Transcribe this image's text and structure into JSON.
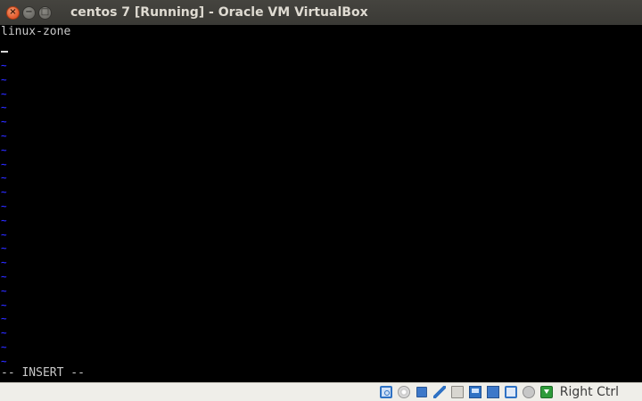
{
  "window": {
    "title": "centos 7 [Running] - Oracle VM VirtualBox",
    "buttons": {
      "close": "×",
      "minimize": "−",
      "maximize": "□"
    }
  },
  "terminal": {
    "first_line": "linux-zone",
    "empty_line_marker": "~",
    "empty_line_count": 22,
    "mode_line": "-- INSERT --",
    "colors": {
      "background": "#000000",
      "text": "#c8c8c8",
      "tilde": "#2a2aff"
    }
  },
  "statusbar": {
    "icons": [
      "hard-disk-icon",
      "optical-drive-icon",
      "network-icon",
      "usb-icon",
      "shared-folders-icon",
      "display-icon",
      "video-capture-icon",
      "cpu-icon",
      "mouse-integration-icon",
      "keyboard-capture-icon"
    ],
    "host_key_label": "Right Ctrl"
  }
}
